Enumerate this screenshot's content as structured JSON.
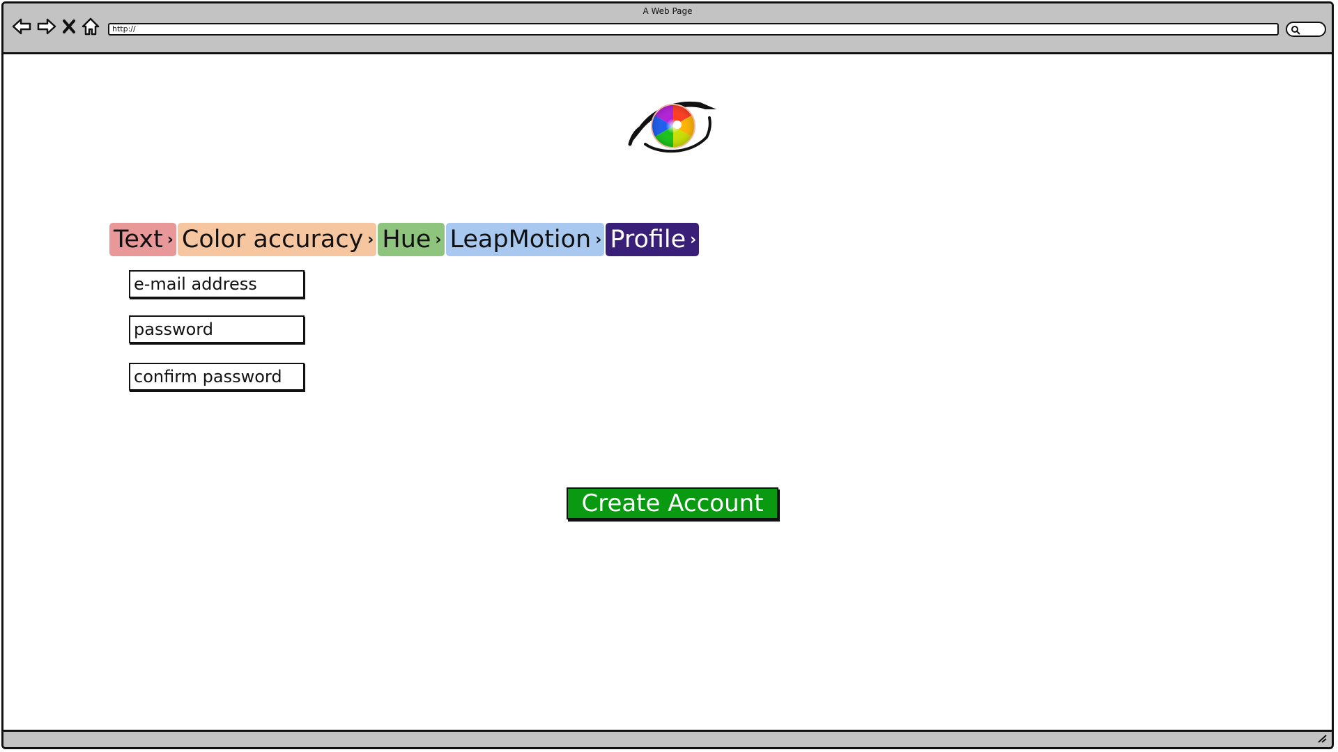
{
  "window": {
    "title": "A Web Page",
    "url": "http://"
  },
  "icons": {
    "back": "arrow-left-icon",
    "forward": "arrow-right-icon",
    "stop": "close-icon",
    "home": "home-icon",
    "search": "search-icon",
    "resize": "resize-grip-icon",
    "logo": "rainbow-eye-logo"
  },
  "breadcrumbs": [
    {
      "label": "Text",
      "color": "#e9989a",
      "text_color": "#111111"
    },
    {
      "label": "Color accuracy",
      "color": "#f6c6a0",
      "text_color": "#111111"
    },
    {
      "label": "Hue",
      "color": "#8fc47e",
      "text_color": "#111111"
    },
    {
      "label": "LeapMotion",
      "color": "#a8c8f0",
      "text_color": "#111111"
    },
    {
      "label": "Profile",
      "color": "#3a1f78",
      "text_color": "#ffffff"
    }
  ],
  "breadcrumb_separator": "›",
  "form": {
    "email_placeholder": "e-mail address",
    "password_placeholder": "password",
    "confirm_placeholder": "confirm password"
  },
  "create_button": {
    "label": "Create Account",
    "color": "#0a9a12"
  }
}
